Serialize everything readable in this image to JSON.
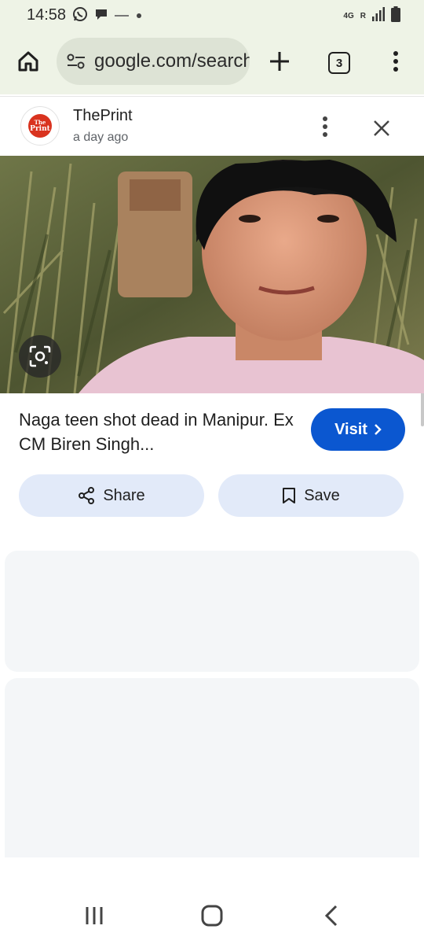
{
  "status_bar": {
    "time": "14:58",
    "network": "4G",
    "roaming": "R",
    "icons": [
      "whatsapp-icon",
      "chat-icon",
      "notification-icon",
      "dot-icon",
      "signal-icon",
      "battery-icon"
    ]
  },
  "browser": {
    "url": "google.com/search",
    "tab_count": "3"
  },
  "source": {
    "name": "ThePrint",
    "time": "a day ago",
    "logo_text_top": "The",
    "logo_text_bottom": "Print"
  },
  "result": {
    "title": "Naga teen shot dead in Manipur. Ex CM Biren Singh...",
    "visit_label": "Visit"
  },
  "actions": {
    "share_label": "Share",
    "save_label": "Save"
  },
  "colors": {
    "visit_blue": "#0b57d0",
    "chip_bg": "#e2eaf9",
    "toolbar_bg": "#eef3e6",
    "placeholder_bg": "#f4f6f8",
    "logo_red": "#d9331f"
  }
}
